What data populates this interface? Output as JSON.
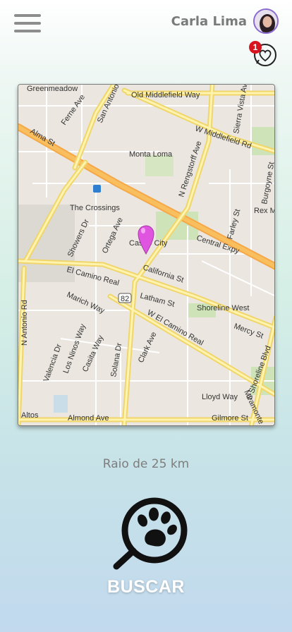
{
  "header": {
    "user_name": "Carla Lima",
    "notification_count": "1"
  },
  "map": {
    "labels": {
      "greenmeadow": "Greenmeadow",
      "ferne": "Ferne Ave",
      "san_antonio": "San Antonio",
      "old_middlefield": "Old Middlefield Way",
      "w_middlefield": "W Middlefield Rd",
      "alma": "Alma St",
      "monta_loma": "Monta Loma",
      "n_rengstorff": "N Rengstorff Ave",
      "burgoyne": "Burgoyne St",
      "rex_m": "Rex M",
      "crossings": "The Crossings",
      "showers": "Showers Dr",
      "ortega": "Ortega Ave",
      "castro_city": "Castro City",
      "central_expy": "Central Expy",
      "farley": "Farley St",
      "california": "California St",
      "el_camino": "El Camino Real",
      "marich": "Marich Way",
      "route_82": "82",
      "latham": "Latham St",
      "shoreline_west": "Shoreline West",
      "n_antonio_rd": "N Antonio Rd",
      "w_el_camino": "W El Camino Real",
      "mercy": "Mercy St",
      "shoreline_blvd": "S Shoreline Blvd",
      "valencia": "Valencia Dr",
      "los_ninos": "Los Ninos Way",
      "casita": "Casita Way",
      "solana": "Solana Dr",
      "clark": "Clark Ave",
      "lloyd": "Lloyd Way",
      "miramonte": "Miramonte",
      "altos": "Altos",
      "almond": "Almond Ave",
      "gilmore": "Gilmore St",
      "sierra_vista": "Sierra Vista Ave"
    }
  },
  "radius_text": "Raio de 25 km",
  "search_label": "BUSCAR",
  "colors": {
    "accent": "#8a6ad0",
    "badge": "#d8151f",
    "pin": "#e055e0"
  },
  "icons": {
    "menu": "hamburger-icon",
    "favorites": "heart-chat-icon",
    "search": "paw-magnifier-icon"
  }
}
